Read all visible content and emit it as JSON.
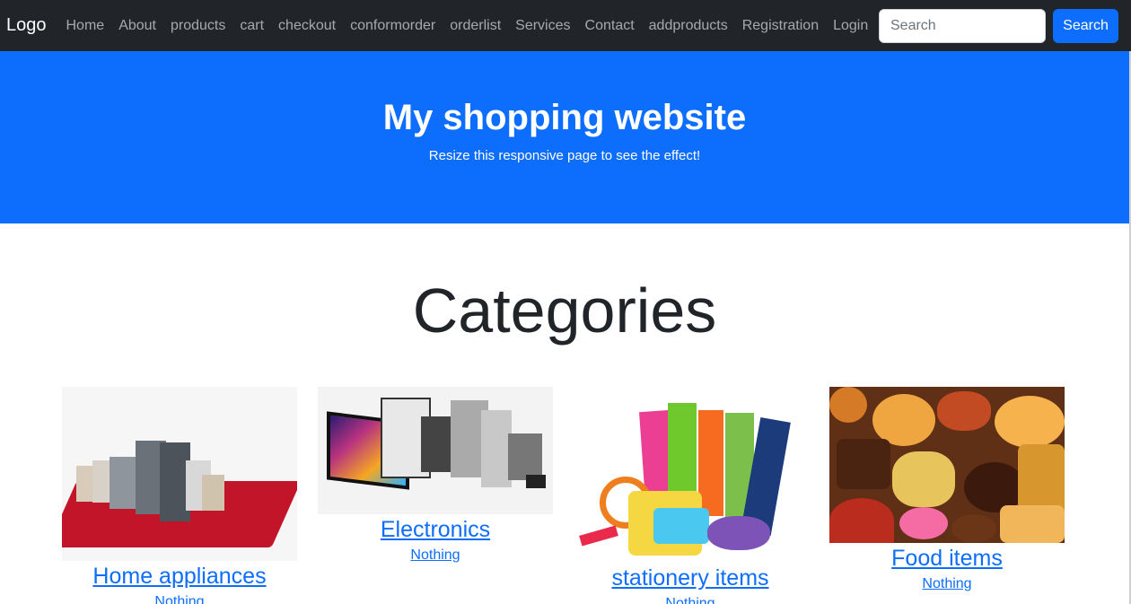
{
  "navbar": {
    "brand": "Logo",
    "links": [
      "Home",
      "About",
      "products",
      "cart",
      "checkout",
      "conformorder",
      "orderlist",
      "Services",
      "Contact",
      "addproducts",
      "Registration",
      "Login"
    ],
    "search": {
      "placeholder": "Search",
      "button_label": "Search"
    }
  },
  "hero": {
    "title": "My shopping website",
    "subtitle": "Resize this responsive page to see the effect!"
  },
  "categories": {
    "title": "Categories",
    "items": [
      {
        "title": "Home appliances",
        "link": "Nothing"
      },
      {
        "title": "Electronics",
        "link": "Nothing"
      },
      {
        "title": "stationery items",
        "link": "Nothing"
      },
      {
        "title": "Food items",
        "link": "Nothing"
      }
    ]
  },
  "colors": {
    "navbar": "#212529",
    "primary": "#0d6efd",
    "text": "#212529"
  }
}
